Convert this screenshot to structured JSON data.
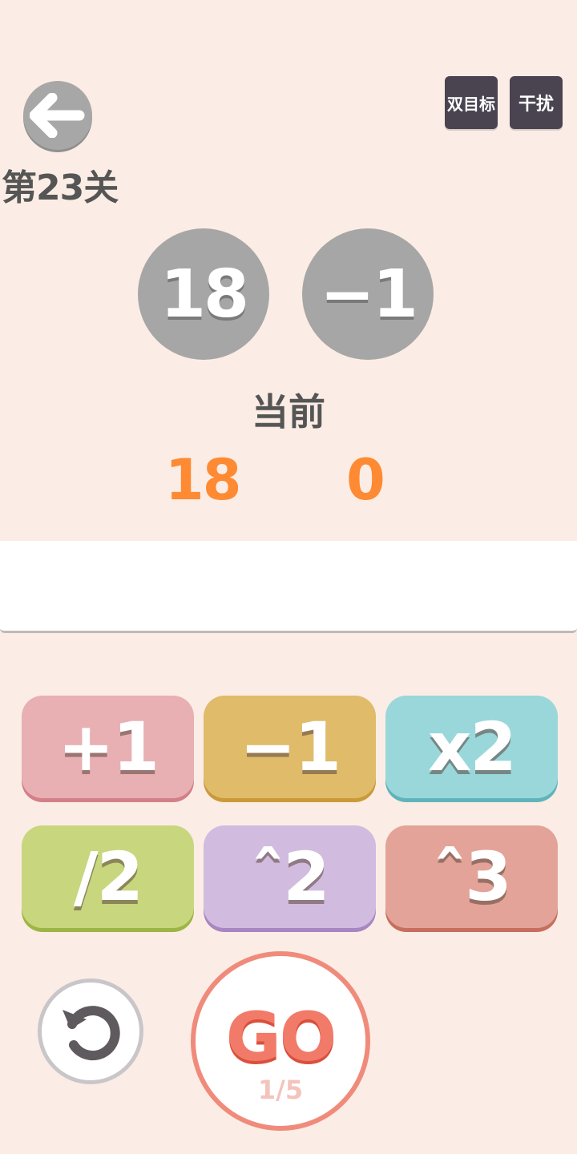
{
  "header": {
    "level_title": "第23关",
    "tags": [
      "双目标",
      "干扰"
    ]
  },
  "targets": [
    "18",
    "−1"
  ],
  "current": {
    "label": "当前",
    "values": [
      "18",
      "0"
    ]
  },
  "operations": [
    "+1",
    "−1",
    "x2",
    "/2",
    "ˆ2",
    "ˆ3"
  ],
  "go": {
    "label": "GO",
    "steps": "1/5"
  },
  "icons": {
    "back": "arrow-left-icon",
    "reset": "undo-icon"
  },
  "colors": {
    "background": "#fbede5",
    "current_value": "#fe8a33",
    "target_circle": "#a6a6a6",
    "go_accent": "#f27a68"
  }
}
